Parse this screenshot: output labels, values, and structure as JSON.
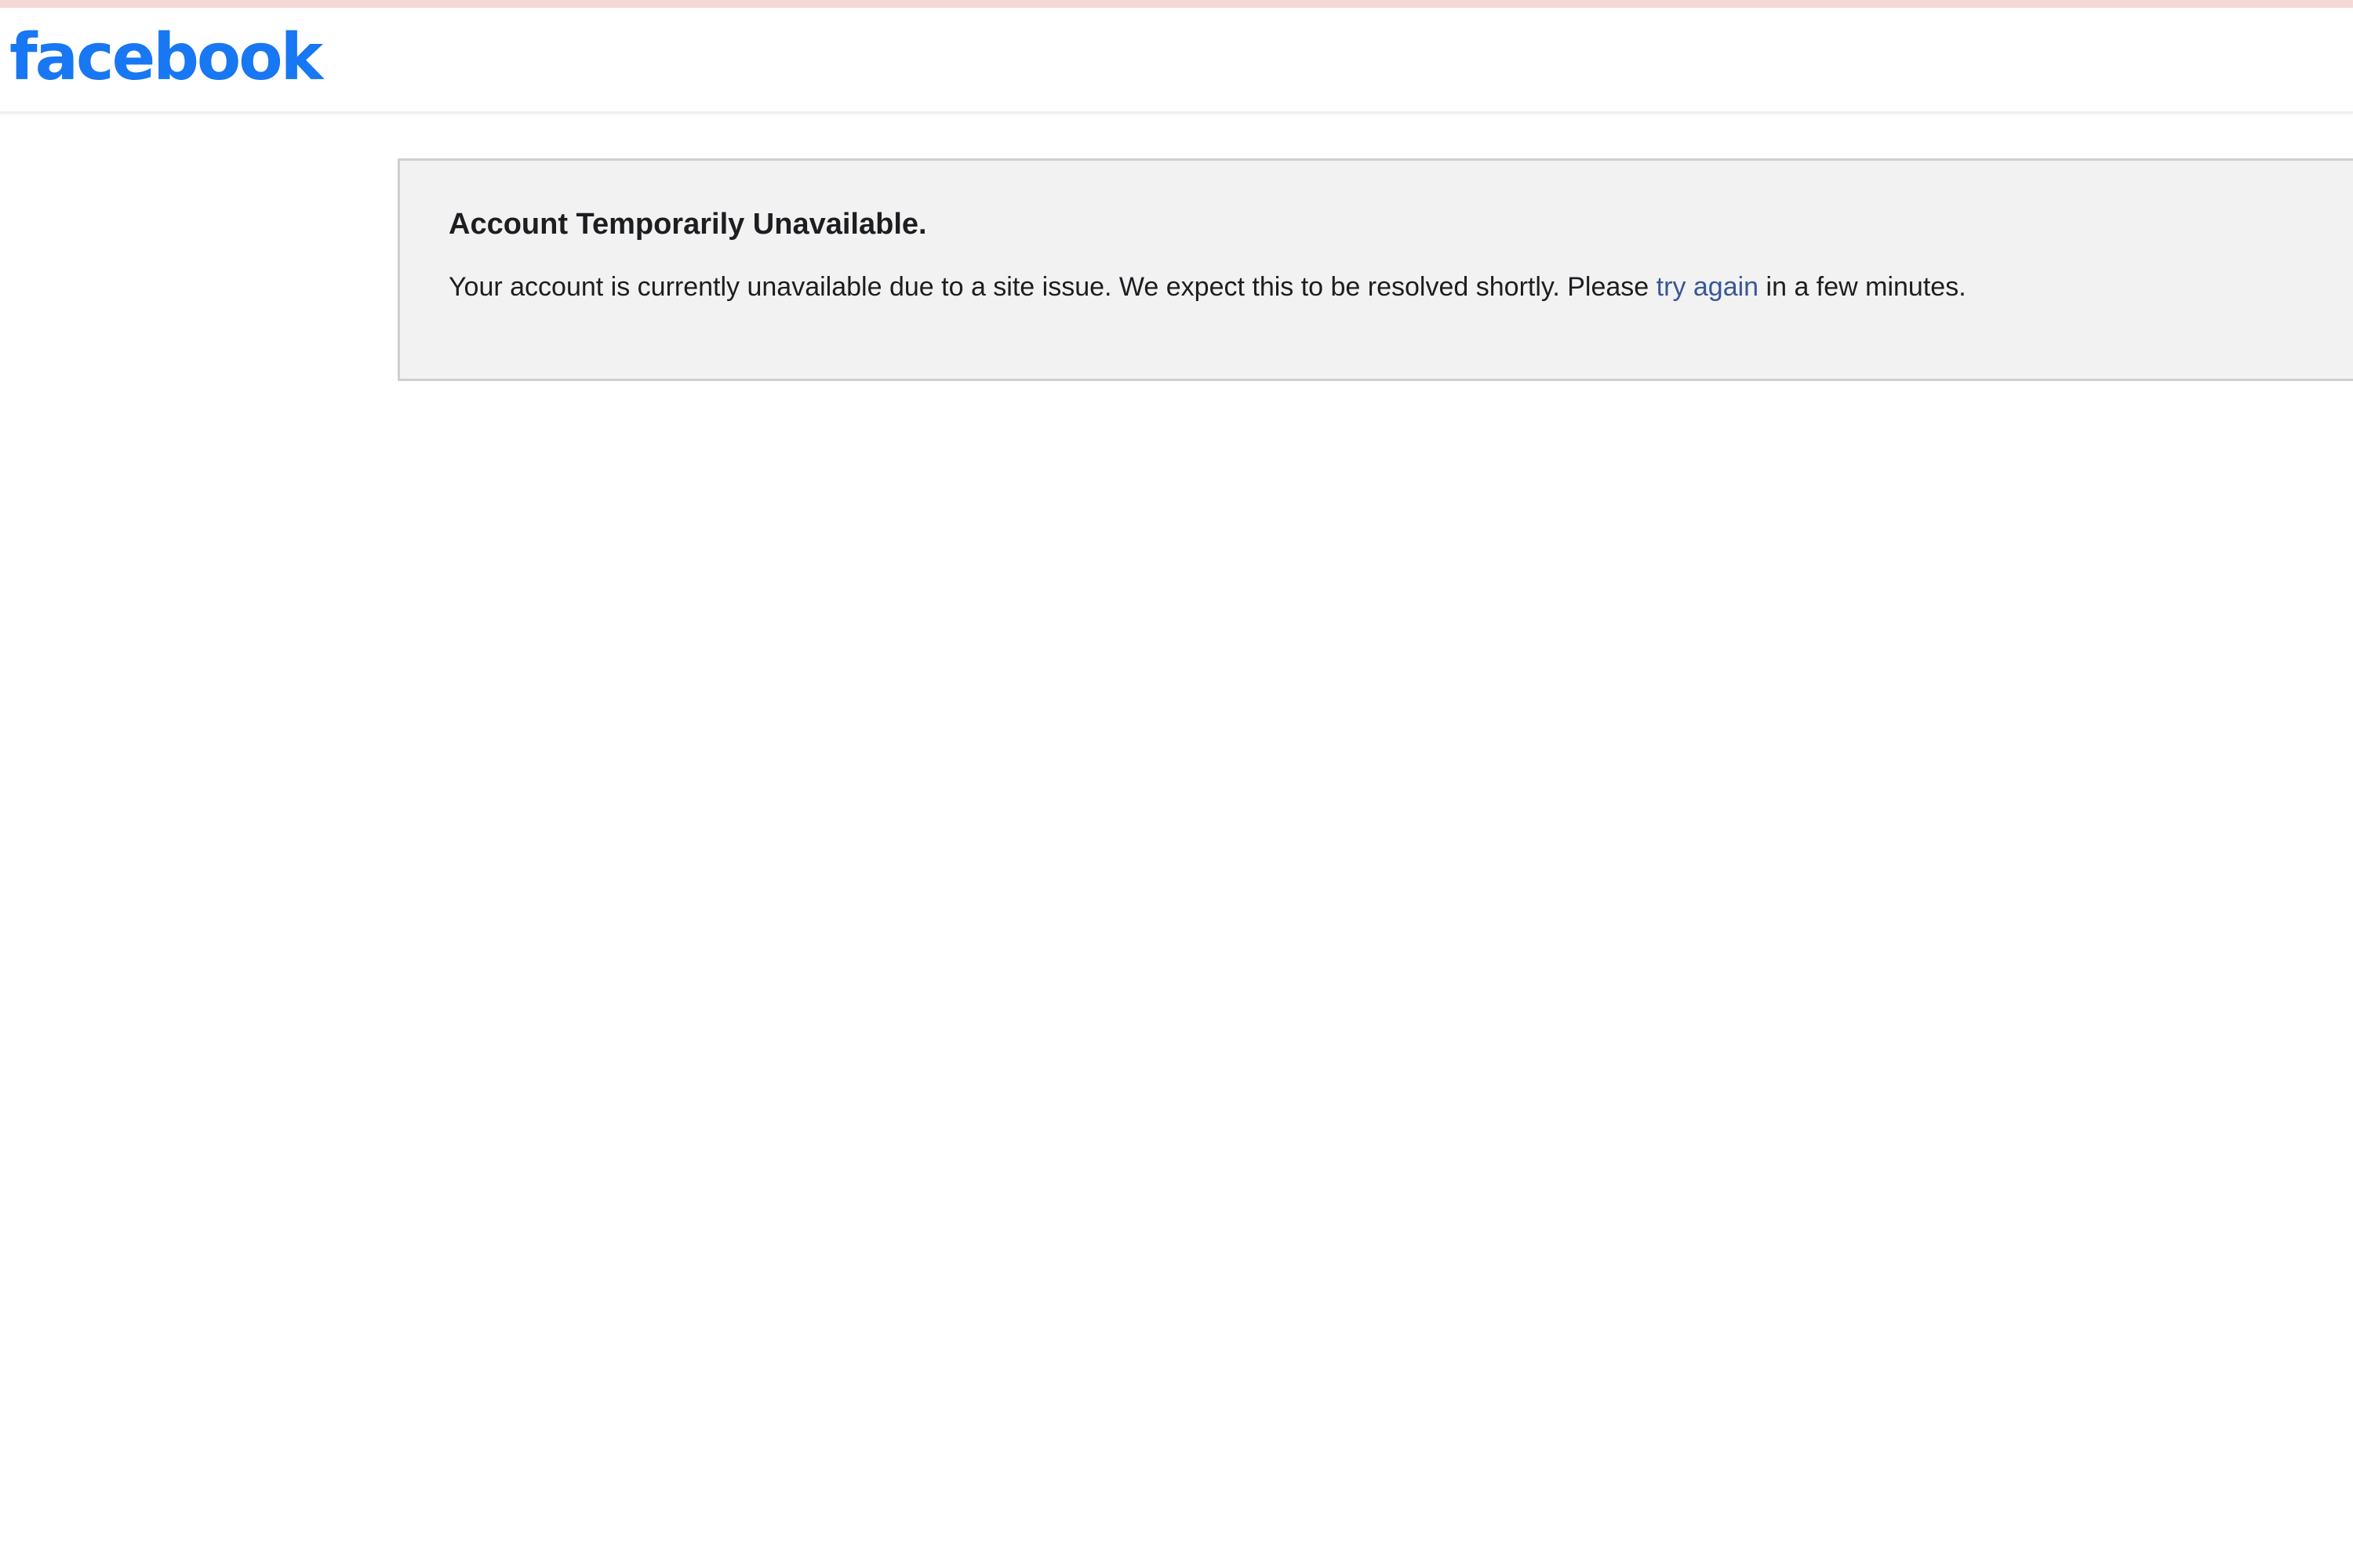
{
  "header": {
    "logo_text": "facebook"
  },
  "notice": {
    "title": "Account Temporarily Unavailable.",
    "message_before": "Your account is currently unavailable due to a site issue. We expect this to be resolved shortly. Please",
    "link_text": "try again",
    "message_after": "in a few minutes."
  },
  "colors": {
    "brand_blue": "#1877f2",
    "link_blue": "#385898",
    "notice_background": "#f2f2f2",
    "notice_border": "#cfcfcf",
    "top_stripe": "#f4d9d7"
  }
}
